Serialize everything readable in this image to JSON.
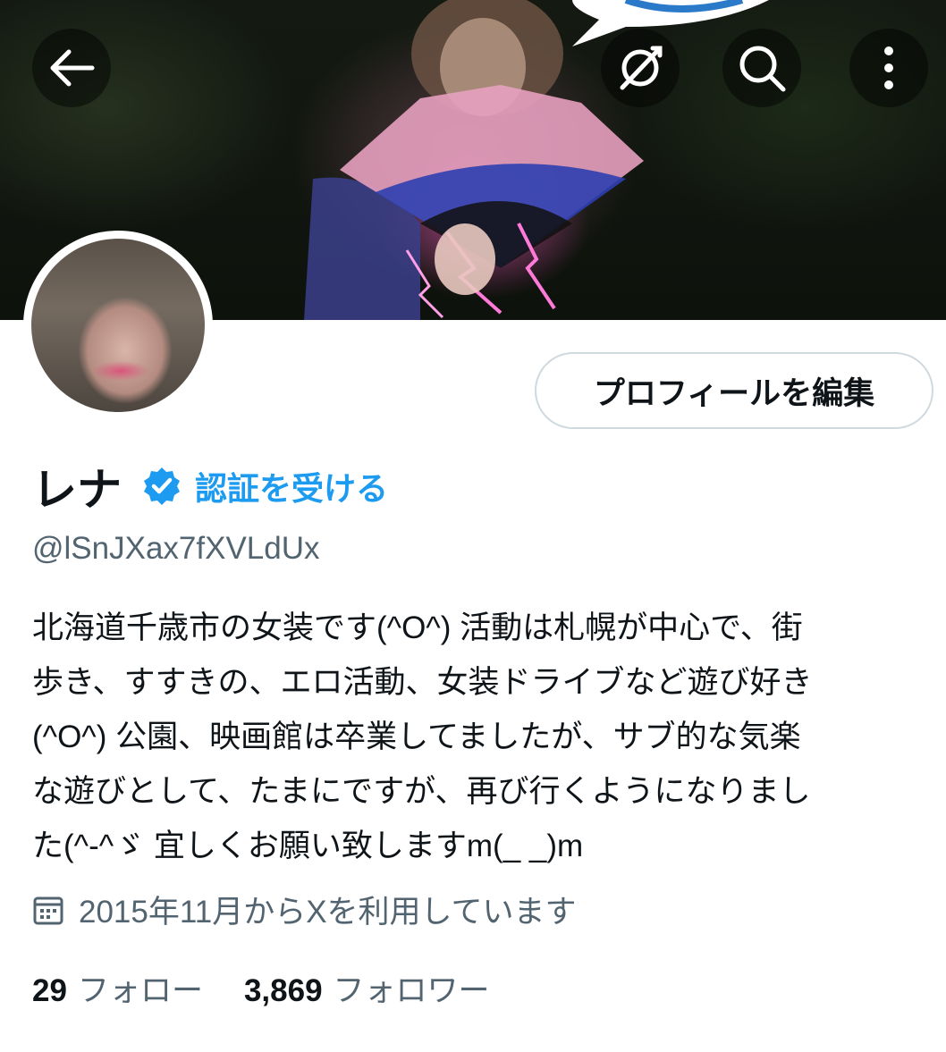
{
  "header": {
    "back_icon": "arrow-left-icon",
    "spaces_icon": "rocket-compass-icon",
    "search_icon": "search-icon",
    "more_icon": "more-vertical-icon"
  },
  "profile": {
    "edit_button_label": "プロフィールを編集",
    "display_name": "レナ",
    "verify_label": "認証を受ける",
    "handle": "@lSnJXax7fXVLdUx",
    "bio_lines": [
      "北海道千歳市の女装です(^O^) 活動は札幌が中心で、街",
      "歩き、すすきの、エロ活動、女装ドライブなど遊び好き",
      "(^O^) 公園、映画館は卒業してましたが、サブ的な気楽",
      "な遊びとして、たまにですが、再び行くようになりまし",
      "た(^-^ゞ 宜しくお願い致しますm(_ _)m"
    ],
    "joined_text": "2015年11月からXを利用しています",
    "following_count": "29",
    "following_label": "フォロー",
    "followers_count": "3,869",
    "followers_label": "フォロワー"
  },
  "colors": {
    "accent": "#1d9bf0",
    "text": "#0f1419",
    "secondary": "#536471",
    "border": "#cfd9de"
  }
}
